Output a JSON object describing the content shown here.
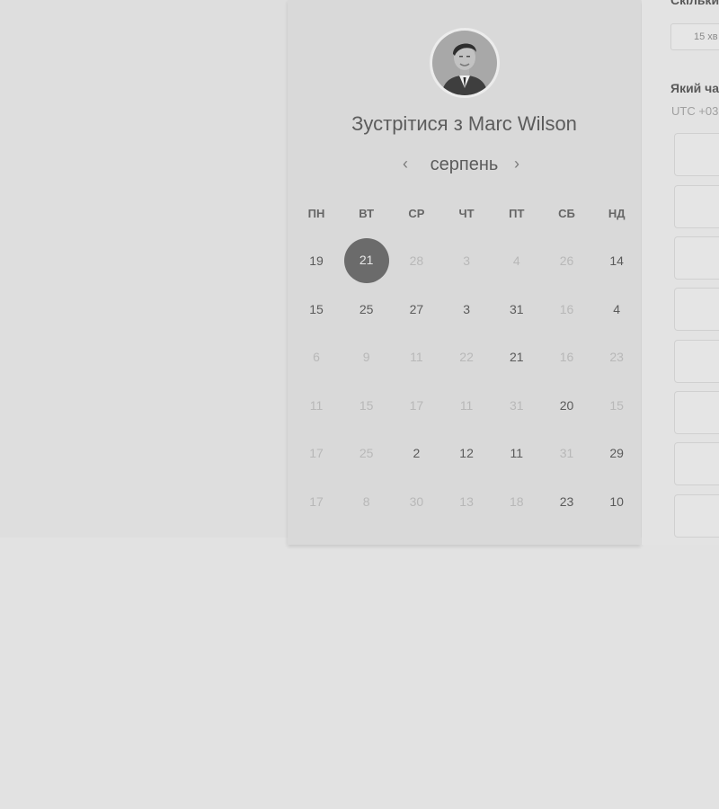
{
  "booking": {
    "title": "Зустрітися з Marc Wilson",
    "month": "серпень",
    "prev_icon": "chevron-left-icon",
    "next_icon": "chevron-right-icon",
    "weekdays": [
      "ПН",
      "ВТ",
      "СР",
      "ЧТ",
      "ПТ",
      "СБ",
      "НД"
    ],
    "weeks": [
      [
        {
          "d": "19",
          "s": "active"
        },
        {
          "d": "21",
          "s": "selected"
        },
        {
          "d": "28",
          "s": "muted"
        },
        {
          "d": "3",
          "s": "muted"
        },
        {
          "d": "4",
          "s": "muted"
        },
        {
          "d": "26",
          "s": "muted"
        },
        {
          "d": "14",
          "s": "active"
        }
      ],
      [
        {
          "d": "15",
          "s": "active"
        },
        {
          "d": "25",
          "s": "active"
        },
        {
          "d": "27",
          "s": "active"
        },
        {
          "d": "3",
          "s": "active"
        },
        {
          "d": "31",
          "s": "active"
        },
        {
          "d": "16",
          "s": "muted"
        },
        {
          "d": "4",
          "s": "active"
        }
      ],
      [
        {
          "d": "6",
          "s": "muted"
        },
        {
          "d": "9",
          "s": "muted"
        },
        {
          "d": "11",
          "s": "muted"
        },
        {
          "d": "22",
          "s": "muted"
        },
        {
          "d": "21",
          "s": "active"
        },
        {
          "d": "16",
          "s": "muted"
        },
        {
          "d": "23",
          "s": "muted"
        }
      ],
      [
        {
          "d": "11",
          "s": "muted"
        },
        {
          "d": "15",
          "s": "muted"
        },
        {
          "d": "17",
          "s": "muted"
        },
        {
          "d": "11",
          "s": "muted"
        },
        {
          "d": "31",
          "s": "muted"
        },
        {
          "d": "20",
          "s": "active"
        },
        {
          "d": "15",
          "s": "muted"
        }
      ],
      [
        {
          "d": "17",
          "s": "muted"
        },
        {
          "d": "25",
          "s": "muted"
        },
        {
          "d": "2",
          "s": "active"
        },
        {
          "d": "12",
          "s": "active"
        },
        {
          "d": "11",
          "s": "active"
        },
        {
          "d": "31",
          "s": "muted"
        },
        {
          "d": "29",
          "s": "active"
        }
      ],
      [
        {
          "d": "17",
          "s": "muted"
        },
        {
          "d": "8",
          "s": "muted"
        },
        {
          "d": "30",
          "s": "muted"
        },
        {
          "d": "13",
          "s": "muted"
        },
        {
          "d": "18",
          "s": "muted"
        },
        {
          "d": "23",
          "s": "active"
        },
        {
          "d": "10",
          "s": "active"
        }
      ]
    ]
  },
  "side": {
    "duration_label": "Скільки",
    "duration_value": "15 хв",
    "time_label": "Який час",
    "timezone": "UTC +03"
  },
  "colors": {
    "selected_day": "#6b6b6b",
    "muted_day": "#b8b8b8",
    "card": "#d9d9d9"
  }
}
